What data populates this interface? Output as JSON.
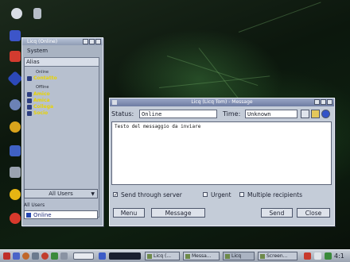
{
  "licq_window": {
    "title": "Licq (Online)",
    "menu_system": "System",
    "list_header": "Alias",
    "group_online": "Online",
    "group_offline": "Offline",
    "contacts_online": [
      "Contatto"
    ],
    "contacts_offline": [
      "Amico",
      "Amica",
      "Collega",
      "Socio"
    ],
    "group_filter_value": "All Users",
    "group_label": "All Users",
    "status_value": "Online"
  },
  "message_window": {
    "title": "Licq (Licq Tom) - Message",
    "status_label": "Status:",
    "status_value": "Online",
    "time_label": "Time:",
    "time_value": "Unknown",
    "body_text": "Testo del messaggio da inviare",
    "option_send_through_server": "Send through server",
    "option_send_through_server_checked": true,
    "option_urgent": "Urgent",
    "option_urgent_checked": false,
    "option_multiple": "Multiple recipients",
    "option_multiple_checked": false,
    "menu_button": "Menu",
    "message_button": "Message",
    "send_button": "Send",
    "close_button": "Close"
  },
  "taskbar": {
    "tasks": [
      "Licq (...",
      "Messa...",
      "Licq",
      "Screen..."
    ],
    "clock": "4:1"
  },
  "colors": {
    "contact_text": "#e8d300",
    "titlebar": "#7f8db0",
    "wallpaper": "#0e1f10"
  }
}
